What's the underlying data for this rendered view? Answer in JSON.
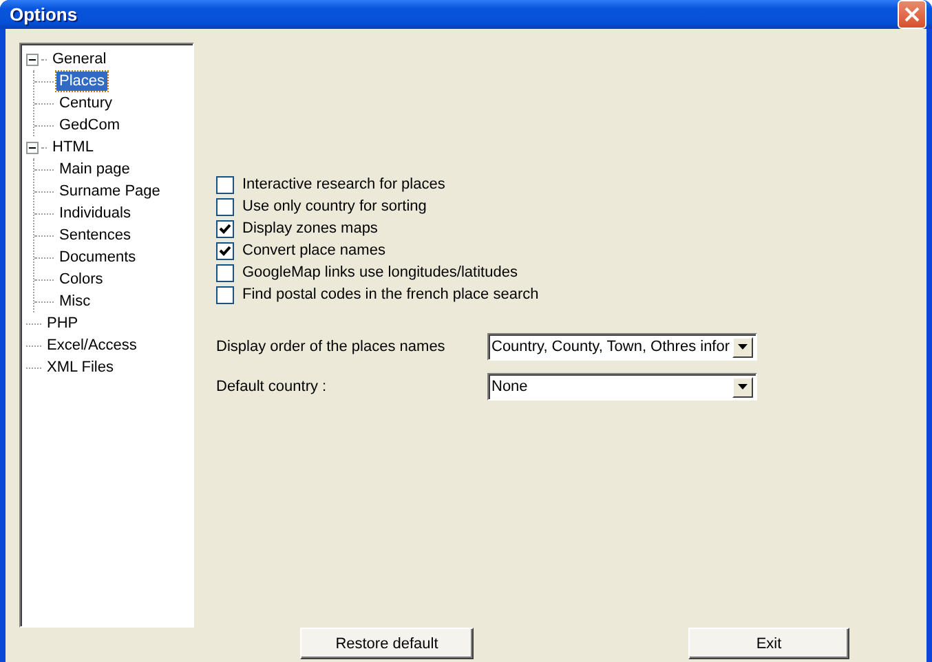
{
  "window": {
    "title": "Options"
  },
  "tree": [
    {
      "label": "General",
      "selected": false,
      "expanded": true,
      "children": [
        {
          "label": "Places",
          "selected": true
        },
        {
          "label": "Century",
          "selected": false
        },
        {
          "label": "GedCom",
          "selected": false
        }
      ]
    },
    {
      "label": "HTML",
      "selected": false,
      "expanded": true,
      "children": [
        {
          "label": "Main page",
          "selected": false
        },
        {
          "label": "Surname Page",
          "selected": false
        },
        {
          "label": "Individuals",
          "selected": false
        },
        {
          "label": "Sentences",
          "selected": false
        },
        {
          "label": "Documents",
          "selected": false
        },
        {
          "label": "Colors",
          "selected": false
        },
        {
          "label": "Misc",
          "selected": false
        }
      ]
    },
    {
      "label": "PHP",
      "selected": false
    },
    {
      "label": "Excel/Access",
      "selected": false
    },
    {
      "label": "XML Files",
      "selected": false
    }
  ],
  "options": [
    {
      "label": "Interactive research for places",
      "checked": false
    },
    {
      "label": "Use only country for sorting",
      "checked": false
    },
    {
      "label": "Display zones maps",
      "checked": true
    },
    {
      "label": "Convert place names",
      "checked": true
    },
    {
      "label": "GoogleMap links use longitudes/latitudes",
      "checked": false
    },
    {
      "label": "Find postal codes in the french place search",
      "checked": false
    }
  ],
  "fields": [
    {
      "label": "Display order of the places names",
      "value": "Country, County, Town, Othres infor"
    },
    {
      "label": "Default country :",
      "value": "None"
    }
  ],
  "buttons": [
    "Restore default",
    "Exit"
  ]
}
